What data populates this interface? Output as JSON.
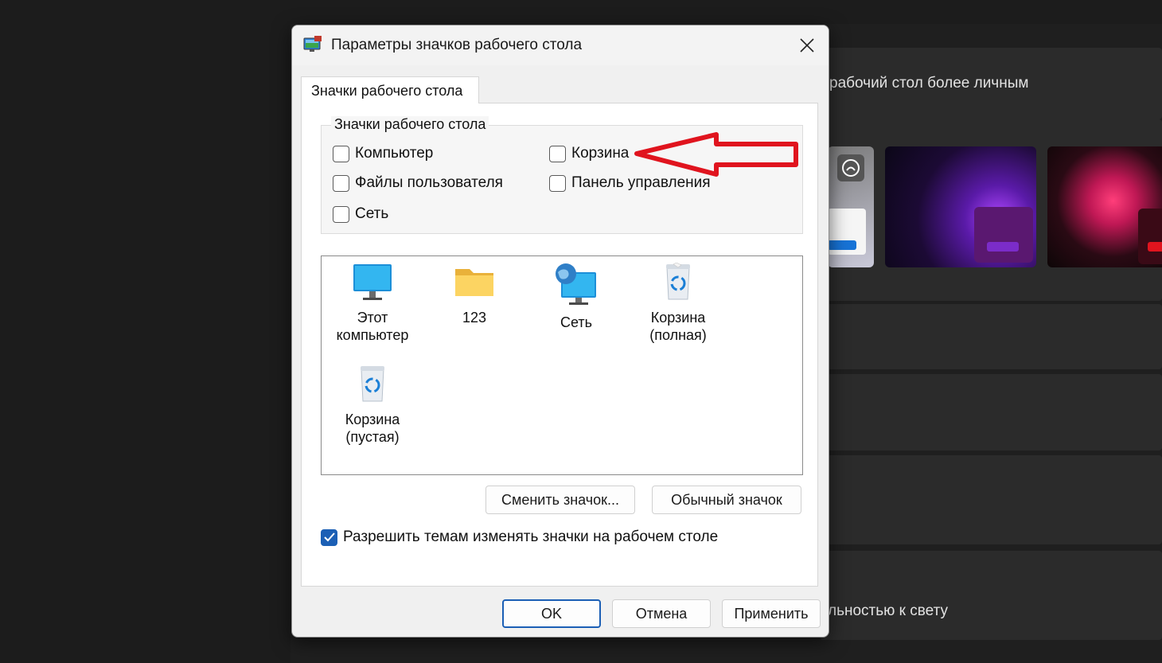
{
  "background": {
    "subtitle_fragment": "рабочий стол более личным",
    "bottom_fragment": "льностью к свету"
  },
  "dialog": {
    "title": "Параметры значков рабочего стола",
    "tab_label": "Значки рабочего стола",
    "group_label": "Значки рабочего стола",
    "checkboxes": [
      {
        "label": "Компьютер",
        "checked": false
      },
      {
        "label": "Корзина",
        "checked": false
      },
      {
        "label": "Файлы пользователя",
        "checked": false
      },
      {
        "label": "Панель управления",
        "checked": false
      },
      {
        "label": "Сеть",
        "checked": false
      }
    ],
    "icons": [
      {
        "label": "Этот компьютер",
        "icon": "monitor-icon"
      },
      {
        "label": "123",
        "icon": "folder-icon"
      },
      {
        "label": "Сеть",
        "icon": "network-icon"
      },
      {
        "label": "Корзина (полная)",
        "icon": "recycle-bin-full-icon"
      },
      {
        "label": "Корзина (пустая)",
        "icon": "recycle-bin-empty-icon"
      }
    ],
    "change_icon_label": "Сменить значок...",
    "default_icon_label": "Обычный значок",
    "allow_themes_label": "Разрешить темам изменять значки на рабочем столе",
    "allow_themes_checked": true,
    "ok_label": "OK",
    "cancel_label": "Отмена",
    "apply_label": "Применить"
  },
  "colors": {
    "accent": "#1b5fb5",
    "annotation_arrow": "#e0141e"
  }
}
